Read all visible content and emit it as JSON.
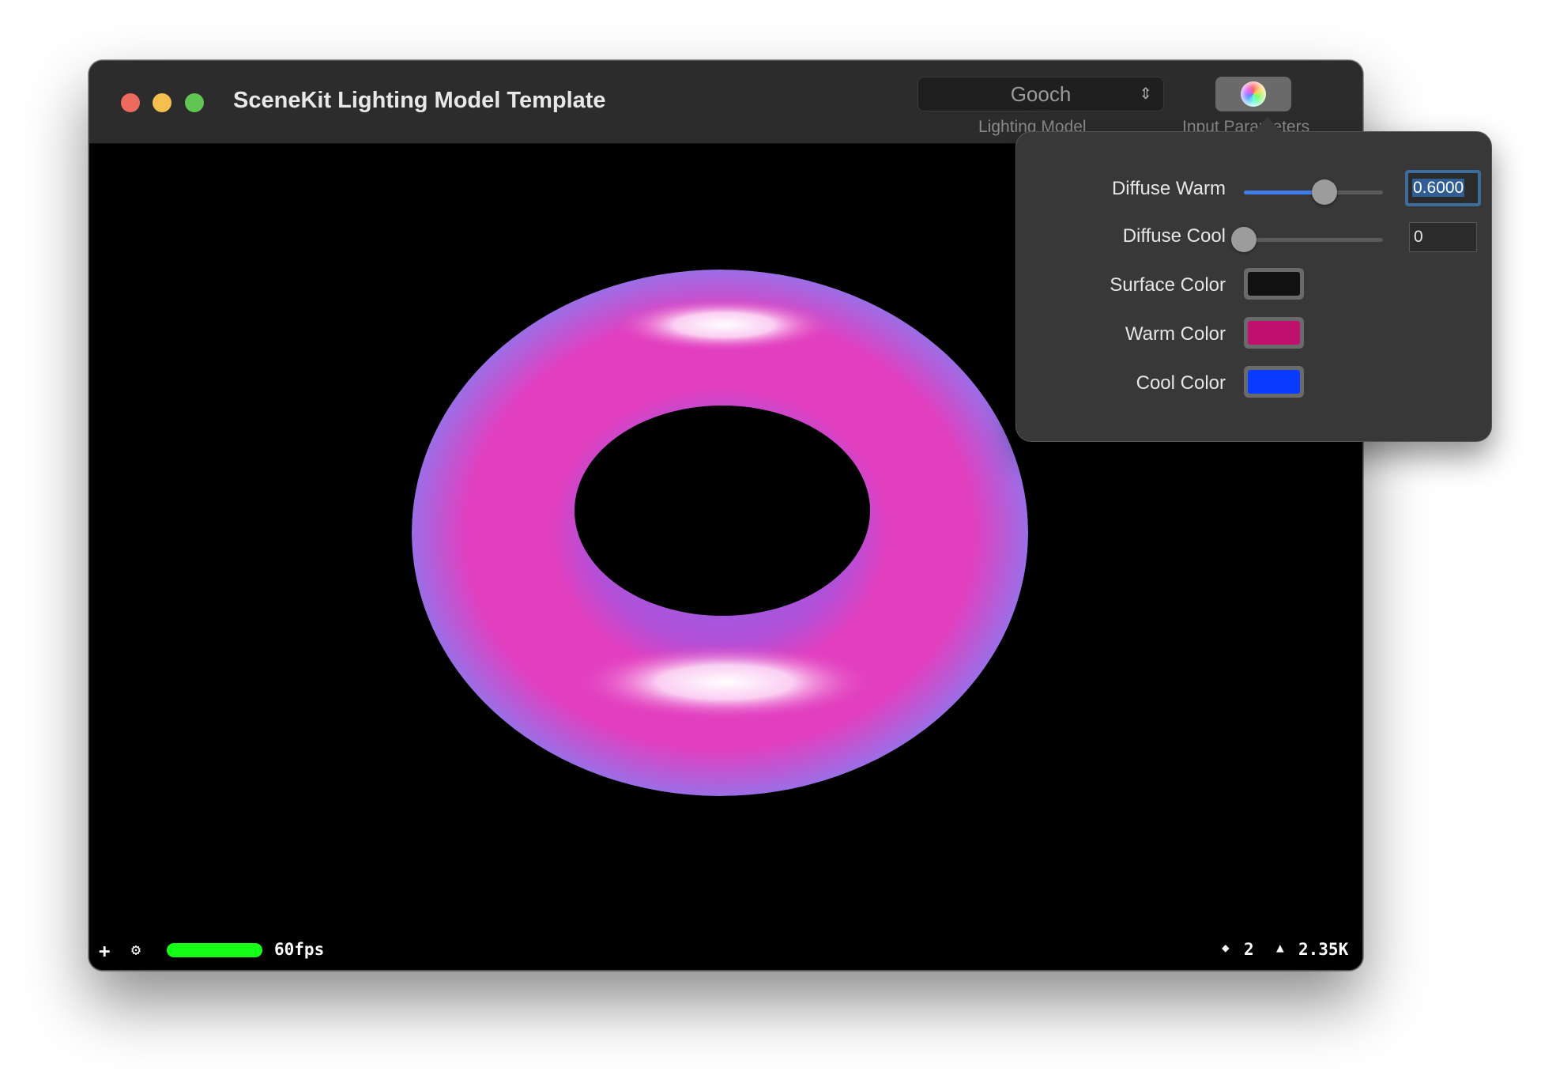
{
  "window": {
    "title": "SceneKit Lighting Model Template"
  },
  "toolbar": {
    "lighting_model_value": "Gooch",
    "lighting_model_label": "Lighting Model",
    "input_parameters_label": "Input Parameters"
  },
  "popover": {
    "diffuse_warm": {
      "label": "Diffuse Warm",
      "value": "0.6000",
      "slider_fraction": 0.58
    },
    "diffuse_cool": {
      "label": "Diffuse Cool",
      "value": "0",
      "slider_fraction": 0.0
    },
    "surface_color": {
      "label": "Surface Color",
      "color": "#111111"
    },
    "warm_color": {
      "label": "Warm Color",
      "color": "#c0106e"
    },
    "cool_color": {
      "label": "Cool Color",
      "color": "#0a3cff"
    }
  },
  "stats": {
    "plus": "+",
    "gear": "⚙",
    "fps": "60fps",
    "nodes": "2",
    "triangles": "2.35K"
  },
  "colors": {
    "torus_pink": "#e23fbf",
    "torus_blue_edge": "#9b6ee6",
    "fps_bar": "#16ff16"
  }
}
